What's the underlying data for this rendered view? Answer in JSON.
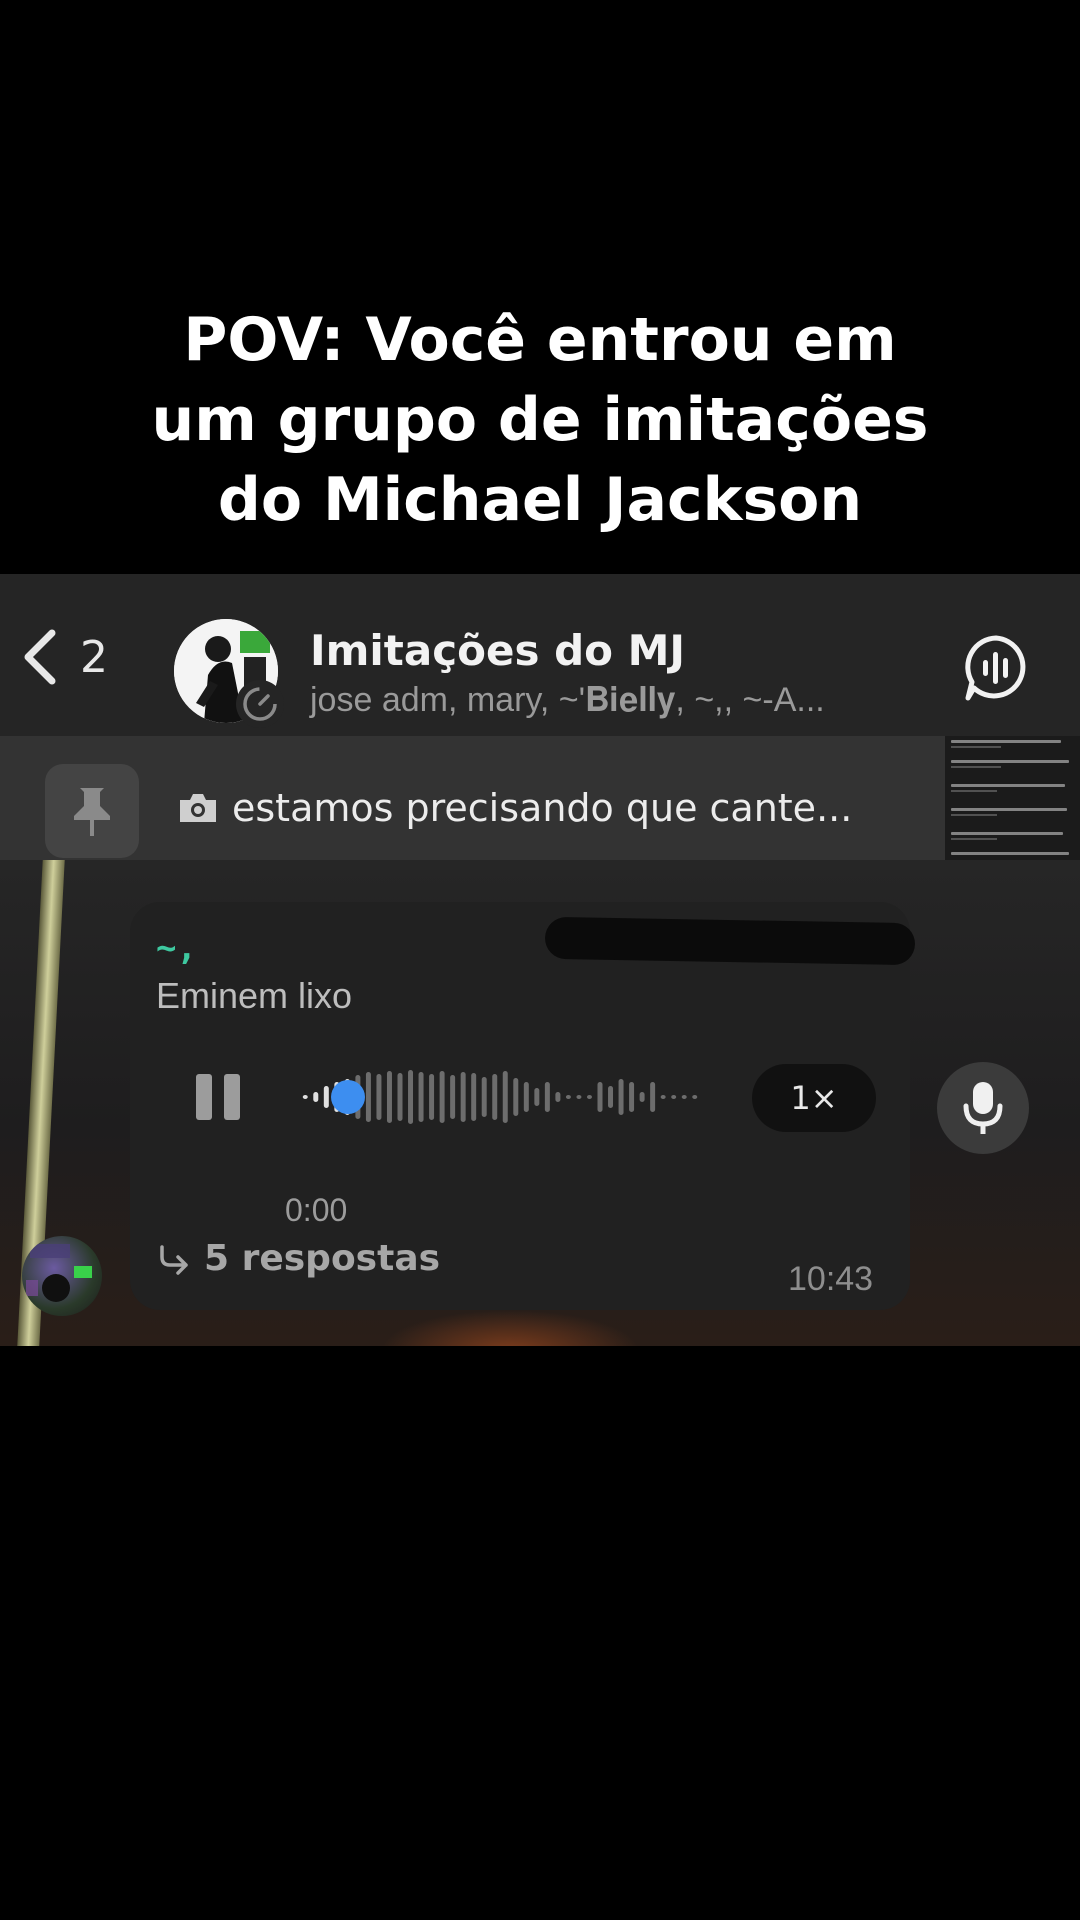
{
  "caption": {
    "line1": "POV: Você entrou em",
    "line2": "um grupo de imitações",
    "line3": "do Michael Jackson"
  },
  "header": {
    "back_count": "2",
    "title": "Imitações do MJ",
    "members": "jose adm, mary, ~'𝐁𝐢𝐞𝐥𝐥𝐲, ~,, ~-A..."
  },
  "pinned": {
    "text": "estamos precisando que cante..."
  },
  "message": {
    "sender": "~,",
    "text": "Eminem lixo",
    "duration": "0:00",
    "playback_progress": 0.12,
    "speed_label": "1×",
    "replies": "5 respostas",
    "time": "10:43"
  },
  "colors": {
    "accent": "#3d8ef0",
    "sender": "#3ec9a0"
  },
  "icons": [
    "chevron-left-icon",
    "timer-icon",
    "voice-chat-icon",
    "pin-icon",
    "camera-icon",
    "pause-icon",
    "microphone-icon",
    "reply-arrow-icon"
  ]
}
